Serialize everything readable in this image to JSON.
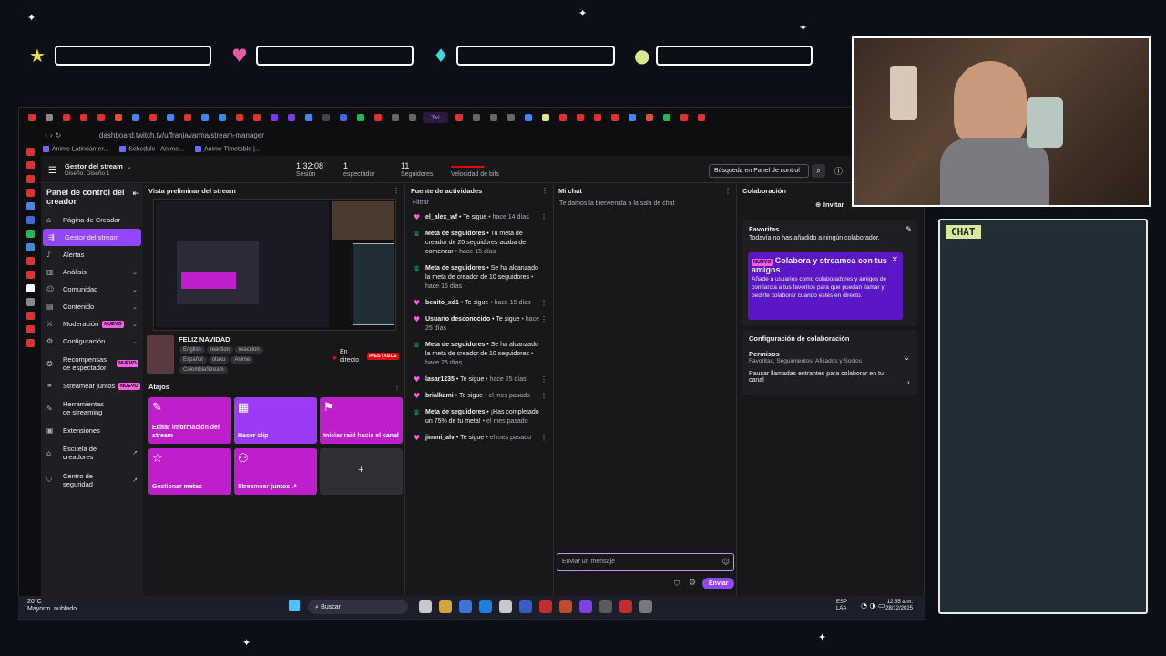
{
  "overlay": {
    "chat_label": "CHAT",
    "hud_icons": [
      "star-icon",
      "heart-icon",
      "diamond-icon",
      "orb-icon"
    ],
    "hud_colors": [
      "#e8e04a",
      "#e85aa8",
      "#40d8e0",
      "#d8e88a"
    ]
  },
  "browser": {
    "url": "dashboard.twitch.tv/u/franjavarma/stream-manager",
    "bookmarks": [
      "Anime Latinoamer...",
      "Schedule - Anime...",
      "Anime Timetable |..."
    ],
    "active_tab": "Twi"
  },
  "topbar": {
    "title": "Gestor del stream",
    "subtitle": "Diseño: Diseño 1",
    "stats": [
      {
        "value": "1:32:08",
        "label": "Sesión"
      },
      {
        "value": "1",
        "label": "espectador"
      },
      {
        "value": "11",
        "label": "Seguidores"
      },
      {
        "value": "",
        "label": "Velocidad de bits"
      }
    ],
    "search_placeholder": "Búsqueda en Panel de control"
  },
  "sidebar": {
    "title": "Panel de control del creador",
    "items": [
      {
        "label": "Página de Creador",
        "icon": "home-icon"
      },
      {
        "label": "Gestor del stream",
        "icon": "stream-manager-icon",
        "active": true
      },
      {
        "label": "Alertas",
        "icon": "alert-icon"
      },
      {
        "label": "Análisis",
        "icon": "analytics-icon",
        "chev": true
      },
      {
        "label": "Comunidad",
        "icon": "community-icon",
        "chev": true
      },
      {
        "label": "Contenido",
        "icon": "content-icon",
        "chev": true
      },
      {
        "label": "Moderación",
        "icon": "moderation-icon",
        "chev": true,
        "badge": "NUEVO"
      },
      {
        "label": "Configuración",
        "icon": "settings-icon",
        "chev": true
      },
      {
        "label": "Recompensas de espectador",
        "icon": "rewards-icon",
        "chev": true,
        "badge": "NUEVO"
      },
      {
        "label": "Streamear juntos",
        "icon": "stream-together-icon",
        "badge": "NUEVO"
      },
      {
        "label": "Herramientas de streaming",
        "icon": "tools-icon"
      },
      {
        "label": "Extensiones",
        "icon": "extensions-icon"
      },
      {
        "label": "Escuela de creadores",
        "icon": "school-icon",
        "ext": true
      },
      {
        "label": "Centro de seguridad",
        "icon": "safety-icon",
        "ext": true
      }
    ]
  },
  "preview": {
    "title": "Vista preliminar del stream",
    "stream_title": "FELIZ NAVIDAD",
    "tags": [
      "English",
      "reaction",
      "reaccion",
      "Español",
      "otaku",
      "Anime",
      "ColombiaStream"
    ],
    "live_label": "En directo",
    "unstable_badge": "INESTABLE",
    "actions_title": "Atajos",
    "actions": [
      {
        "label": "Editar información del stream",
        "icon": "pencil-icon",
        "color": "#bf1fcb"
      },
      {
        "label": "Hacer clip",
        "icon": "clapper-icon",
        "color": "#9c3bf5"
      },
      {
        "label": "Iniciar raid hacia el canal",
        "icon": "raid-icon",
        "color": "#bf1fcb"
      },
      {
        "label": "Gestionar metas",
        "icon": "star-outline-icon",
        "color": "#bf1fcb"
      },
      {
        "label": "Streamear juntos ↗",
        "icon": "add-user-icon",
        "color": "#bf1fcb"
      },
      {
        "label": "+",
        "icon": "plus-icon",
        "color": "#2f2f35"
      }
    ]
  },
  "activity": {
    "title": "Fuente de actividades",
    "filter": "Filtrar",
    "items": [
      {
        "type": "follow",
        "name": "el_alex_wf",
        "text": " • Te sigue",
        "time": " • hace 14 días"
      },
      {
        "type": "goal",
        "name": "Meta de seguidores",
        "text": " • Tu meta de creador de 20 seguidores acaba de comenzar",
        "time": " • hace 15 días"
      },
      {
        "type": "goal",
        "name": "Meta de seguidores",
        "text": " • Se ha alcanzado la meta de creador de 10 seguidores",
        "time": " • hace 15 días"
      },
      {
        "type": "follow",
        "name": "benito_xd1",
        "text": " • Te sigue",
        "time": " • hace 15 días"
      },
      {
        "type": "follow",
        "name": "Usuario desconocido",
        "text": " • Te sigue",
        "time": " • hace 25 días"
      },
      {
        "type": "goal",
        "name": "Meta de seguidores",
        "text": " • Se ha alcanzado la meta de creador de 10 seguidores",
        "time": " • hace 25 días"
      },
      {
        "type": "follow",
        "name": "lasar1235",
        "text": " • Te sigue",
        "time": " • hace 25 días"
      },
      {
        "type": "follow",
        "name": "brialkami",
        "text": " • Te sigue",
        "time": " • el mes pasado"
      },
      {
        "type": "goal",
        "name": "Meta de seguidores",
        "text": " • ¡Has completado un 75% de tu meta!",
        "time": " • el mes pasado"
      },
      {
        "type": "follow",
        "name": "jimmi_alv",
        "text": " • Te sigue",
        "time": " • el mes pasado"
      }
    ]
  },
  "chat": {
    "title": "Mi chat",
    "welcome": "Te damos la bienvenida a la sala de chat",
    "input_placeholder": "Enviar un mensaje",
    "send_label": "Enviar"
  },
  "collab": {
    "title": "Colaboración",
    "invite_label": "Invitar",
    "favorites_title": "Favoritas",
    "favorites_empty": "Todavía no has añadido a ningún colaborador.",
    "promo_badge": "NUEVO",
    "promo_title": "Colabora y streamea con tus amigos",
    "promo_text": "Añade a usuarios como colaboradores y amigos de confianza a tus favoritos para que puedan llamar y pedirte colaborar cuando estés en directo.",
    "config_title": "Configuración de colaboración",
    "permissions_label": "Permisos",
    "permissions_sub": "Favoritas, Seguimientos, Afiliados y Socios",
    "pause_label": "Pausar llamadas entrantes para colaborar en tu canal"
  },
  "taskbar": {
    "weather_temp": "20°C",
    "weather_desc": "Mayorm. nublado",
    "search_label": "Buscar",
    "lang": "ESP",
    "lang_sub": "LAA",
    "time": "12:55 a.m.",
    "date": "28/12/2025"
  }
}
